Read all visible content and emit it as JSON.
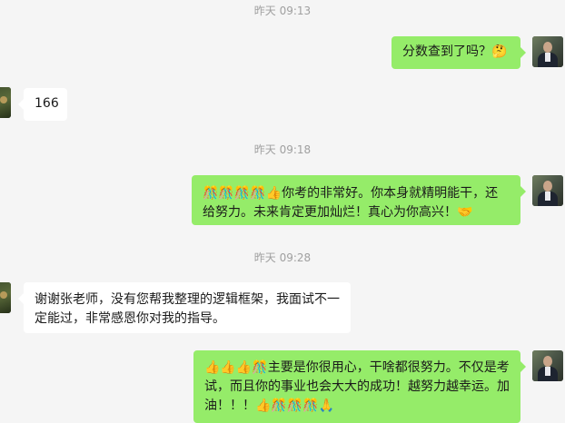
{
  "messages": [
    {
      "type": "timestamp",
      "text": "昨天 09:13"
    },
    {
      "type": "sent",
      "text": "分数查到了吗？🤔"
    },
    {
      "type": "received",
      "text": "166"
    },
    {
      "type": "timestamp",
      "text": "昨天 09:18"
    },
    {
      "type": "sent",
      "text": "🎊🎊🎊🎊👍你考的非常好。你本身就精明能干，还给努力。未来肯定更加灿烂！真心为你高兴！🤝"
    },
    {
      "type": "timestamp",
      "text": "昨天 09:28"
    },
    {
      "type": "received",
      "text": "谢谢张老师，没有您帮我整理的逻辑框架，我面试不一定能过，非常感恩你对我的指导。"
    },
    {
      "type": "sent",
      "text": "👍👍👍🎊主要是你很用心，干啥都很努力。不仅是考试，而且你的事业也会大大的成功！越努力越幸运。加油！！！👍🎊🎊🎊🙏"
    }
  ],
  "colors": {
    "sent_bubble": "#95ec69",
    "received_bubble": "#ffffff",
    "background": "#f5f5f5",
    "timestamp": "#a0a0a0"
  },
  "avatars": {
    "me": "avatar-man-in-suit",
    "other": "avatar-landscape"
  }
}
